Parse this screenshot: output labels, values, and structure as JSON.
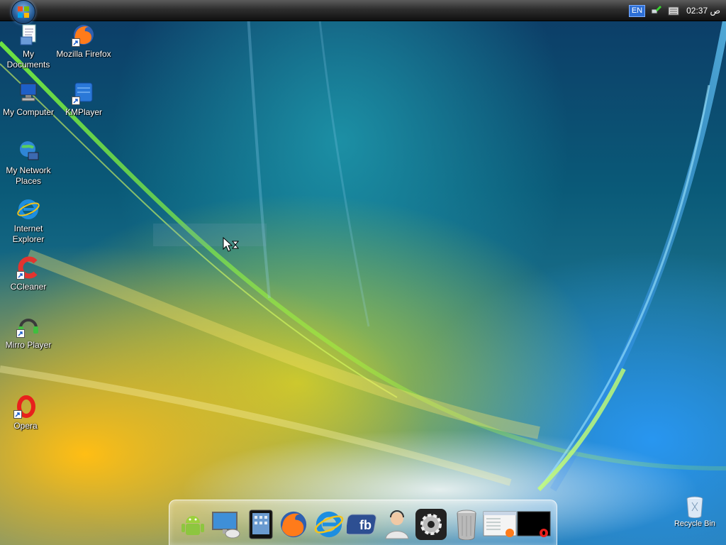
{
  "topbar": {
    "language": "EN",
    "clock": "02:37 ص"
  },
  "desktop_icons": [
    {
      "label": "My Documents",
      "icon": "my-documents-icon"
    },
    {
      "label": "Mozilla Firefox",
      "icon": "firefox-icon"
    },
    {
      "label": "My Computer",
      "icon": "my-computer-icon"
    },
    {
      "label": "KMPlayer",
      "icon": "kmplayer-icon"
    },
    {
      "label": "My Network Places",
      "icon": "network-places-icon"
    },
    {
      "label": "Internet Explorer",
      "icon": "internet-explorer-icon"
    },
    {
      "label": "CCleaner",
      "icon": "ccleaner-icon"
    },
    {
      "label": "Mirro Player",
      "icon": "mirro-player-icon"
    },
    {
      "label": "Opera",
      "icon": "opera-icon"
    }
  ],
  "recycle_bin": {
    "label": "Recycle Bin",
    "icon": "recycle-bin-icon"
  },
  "dock": {
    "items": [
      {
        "icon": "android-icon"
      },
      {
        "icon": "computer-icon"
      },
      {
        "icon": "tablet-icon"
      },
      {
        "icon": "firefox-icon"
      },
      {
        "icon": "internet-explorer-icon"
      },
      {
        "icon": "facebook-icon",
        "text": "fb"
      },
      {
        "icon": "user-support-icon"
      },
      {
        "icon": "settings-gear-icon"
      },
      {
        "icon": "trash-can-icon"
      },
      {
        "icon": "window-preview-icon"
      },
      {
        "icon": "opera-window-icon"
      }
    ]
  },
  "colors": {
    "taskbar": "#1a1a1a",
    "lang_badge": "#2d6fd6"
  }
}
